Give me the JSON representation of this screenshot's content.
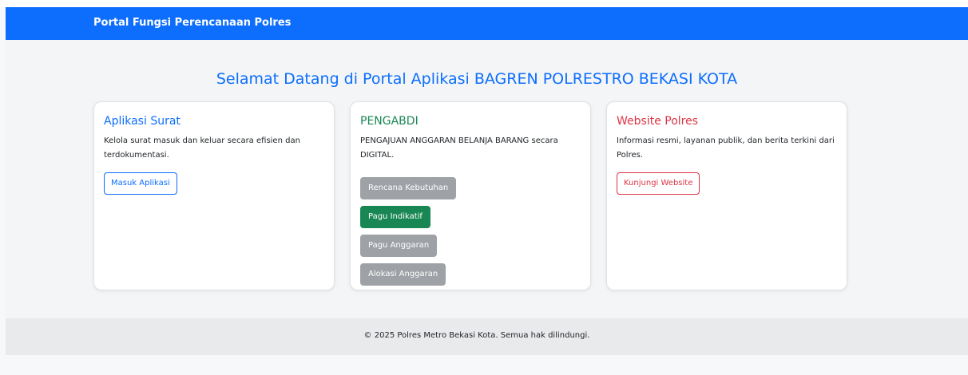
{
  "navbar": {
    "brand": "Portal Fungsi Perencanaan Polres"
  },
  "main": {
    "welcome": "Selamat Datang di Portal Aplikasi BAGREN POLRESTRO BEKASI KOTA"
  },
  "cards": [
    {
      "title": "Aplikasi Surat",
      "text": "Kelola surat masuk dan keluar secara efisien dan terdokumentasi.",
      "button": "Masuk Aplikasi"
    },
    {
      "title": "PENGABDI",
      "text": "PENGAJUAN ANGGARAN BELANJA BARANG secara DIGITAL.",
      "buttons": [
        "Rencana Kebutuhan",
        "Pagu Indikatif",
        "Pagu Anggaran",
        "Alokasi Anggaran"
      ]
    },
    {
      "title": "Website Polres",
      "text": "Informasi resmi, layanan publik, dan berita terkini dari Polres.",
      "button": "Kunjungi Website"
    }
  ],
  "footer": {
    "text": "© 2025 Polres Metro Bekasi Kota. Semua hak dilindungi."
  },
  "colors": {
    "primary": "#0d6efd",
    "success": "#198754",
    "danger": "#dc3545",
    "secondary": "#9ea2a6"
  }
}
